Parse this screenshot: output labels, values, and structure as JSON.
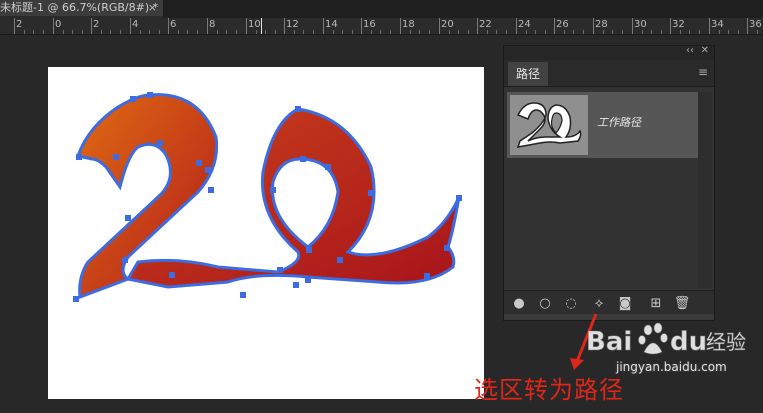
{
  "document_tab": {
    "title": "未标题-1 @ 66.7%(RGB/8#) *",
    "close": "×"
  },
  "ruler": {
    "labels": [
      "2",
      "0",
      "2",
      "4",
      "6",
      "8",
      "10",
      "12",
      "14",
      "16",
      "18",
      "20",
      "22",
      "24",
      "26",
      "28",
      "30",
      "32",
      "34",
      "36"
    ]
  },
  "paths_panel": {
    "collapse_glyph": "‹‹",
    "close_glyph": "✕",
    "tab_label": "路径",
    "menu_glyph": "≡",
    "path_item": {
      "name": "工作路径"
    },
    "footer_buttons": [
      {
        "name": "fill-path-button",
        "glyph": "●"
      },
      {
        "name": "stroke-path-button",
        "glyph": "○"
      },
      {
        "name": "load-as-selection-button",
        "glyph": "◌"
      },
      {
        "name": "make-work-path-button",
        "glyph": "⟡"
      },
      {
        "name": "add-mask-button",
        "glyph": "◙"
      },
      {
        "name": "new-path-button",
        "glyph": "⊞"
      },
      {
        "name": "delete-path-button",
        "glyph": "🗑"
      }
    ]
  },
  "caption": {
    "text": "选区转为路径"
  },
  "watermark": {
    "brand": "Baidu",
    "product": "经验",
    "url": "jingyan.baidu.com"
  },
  "colors": {
    "accent_path": "#3d6be0",
    "shape_orange": "#d35a14",
    "shape_red": "#b01c1c",
    "caption_red": "#e0261a"
  }
}
